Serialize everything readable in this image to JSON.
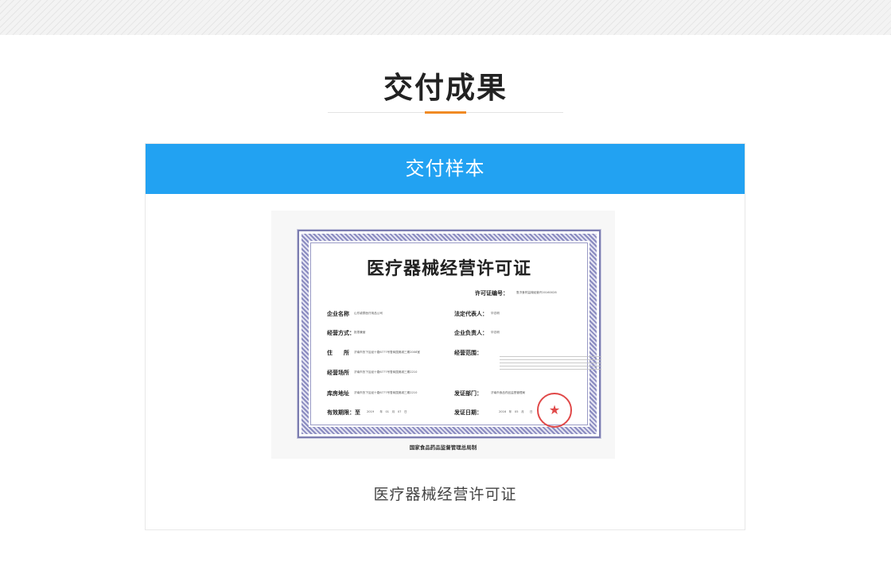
{
  "section": {
    "title": "交付成果"
  },
  "card": {
    "header": "交付样本",
    "caption": "医疗器械经营许可证"
  },
  "certificate": {
    "title": "医疗器械经营许可证",
    "license_no_label": "许可证编号：",
    "license_no_value": "鲁济食药监械经营许20160028",
    "company_label": "企业名称",
    "company_value": "山东颖泰医疗用品公司",
    "legal_rep_label": "法定代表人：",
    "legal_rep_value": "毕志明",
    "mode_label": "经营方式：",
    "mode_value": "批零兼营",
    "principal_label": "企业负责人：",
    "principal_value": "毕志明",
    "address_label": "住　　所",
    "address_value": "济南市历下区经十路6777号鲁商国奥城三期2008室",
    "scope_label": "经营范围：",
    "premises_label": "经营场所",
    "premises_value": "济南市历下区经十路6777号鲁商国奥城三期2210",
    "warehouse_label": "库房地址",
    "warehouse_value": "济南市历下区经十路6777号鲁商国奥城三期2210",
    "issuer_label": "发证部门：",
    "issuer_value": "济南市食品药品监督管理局",
    "valid_label": "有效期限：至",
    "valid_value": "2019　　年　01　月　07　日",
    "issue_date_label": "发证日期：",
    "issue_date_value": "2016　年　05　月　　日",
    "footer": "国家食品药品监督管理总局制",
    "seal_color": "#e04848"
  },
  "colors": {
    "accent": "#f08a24",
    "header_blue": "#22a2f2"
  }
}
